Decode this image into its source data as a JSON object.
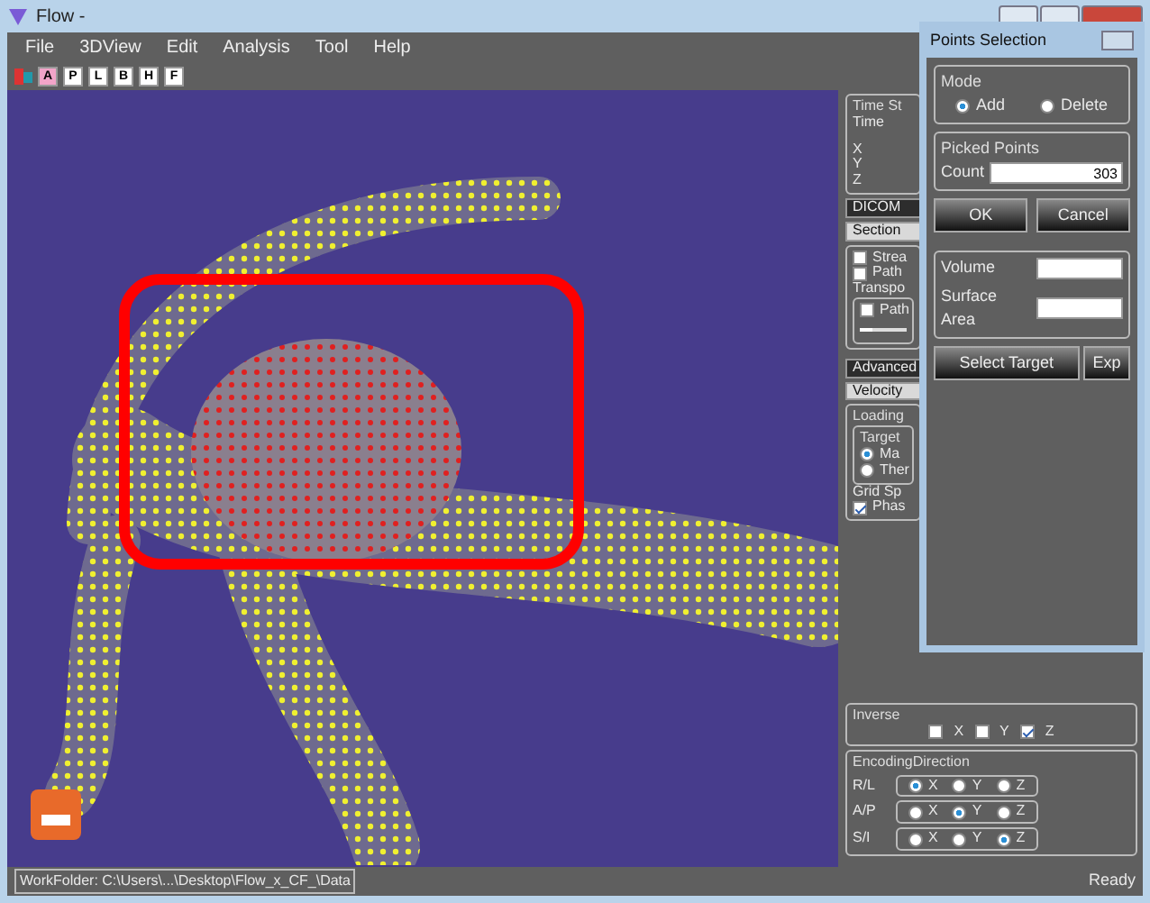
{
  "window": {
    "title": "Flow -"
  },
  "menu": [
    "File",
    "3DView",
    "Edit",
    "Analysis",
    "Tool",
    "Help"
  ],
  "toolbar": [
    {
      "label": "A",
      "selected": true
    },
    {
      "label": "P",
      "selected": false
    },
    {
      "label": "L",
      "selected": false
    },
    {
      "label": "B",
      "selected": false
    },
    {
      "label": "H",
      "selected": false
    },
    {
      "label": "F",
      "selected": false
    }
  ],
  "side_panel": {
    "time_group": {
      "title": "Time St",
      "time_label": "Time",
      "coords": [
        "X",
        "Y",
        "Z"
      ]
    },
    "tabs": [
      {
        "label": "DICOM",
        "selected": false
      },
      {
        "label": "Section",
        "selected": true
      }
    ],
    "options": [
      {
        "label": "Strea",
        "checked": false
      },
      {
        "label": "Path",
        "checked": false
      }
    ],
    "transport_label": "Transpo",
    "path_slider": {
      "label": "Path",
      "checked": false,
      "level": 0.25
    },
    "tabs2": [
      {
        "label": "Advanced",
        "selected": false
      },
      {
        "label": "Velocity",
        "selected": true
      }
    ],
    "loading": {
      "title": "Loading",
      "target_title": "Target",
      "radios": [
        {
          "label": "Ma",
          "selected": true
        },
        {
          "label": "Ther",
          "selected": false
        }
      ],
      "grid_label": "Grid Sp",
      "phase": {
        "label": "Phas",
        "checked": true
      }
    },
    "inverse": {
      "title": "Inverse",
      "checks": [
        {
          "label": "X",
          "checked": false
        },
        {
          "label": "Y",
          "checked": false
        },
        {
          "label": "Z",
          "checked": true
        }
      ]
    },
    "encoding": {
      "title": "EncodingDirection",
      "rows": [
        {
          "label": "R/L",
          "options": [
            {
              "label": "X",
              "selected": true
            },
            {
              "label": "Y",
              "selected": false
            },
            {
              "label": "Z",
              "selected": false
            }
          ]
        },
        {
          "label": "A/P",
          "options": [
            {
              "label": "X",
              "selected": false
            },
            {
              "label": "Y",
              "selected": true
            },
            {
              "label": "Z",
              "selected": false
            }
          ]
        },
        {
          "label": "S/I",
          "options": [
            {
              "label": "X",
              "selected": false
            },
            {
              "label": "Y",
              "selected": false
            },
            {
              "label": "Z",
              "selected": true
            }
          ]
        }
      ]
    }
  },
  "dialog": {
    "title": "Points Selection",
    "mode_title": "Mode",
    "modes": [
      {
        "label": "Add",
        "selected": true
      },
      {
        "label": "Delete",
        "selected": false
      }
    ],
    "picked_title": "Picked Points",
    "count_label": "Count",
    "count_value": "303",
    "buttons": [
      "OK",
      "Cancel"
    ],
    "volume_label": "Volume",
    "surface_label": "Surface Area",
    "actions": [
      "Select Target",
      "Exp"
    ]
  },
  "status_bar": {
    "path": "WorkFolder: C:\\Users\\...\\Desktop\\Flow_x_CF_\\Data",
    "state": "Ready"
  }
}
